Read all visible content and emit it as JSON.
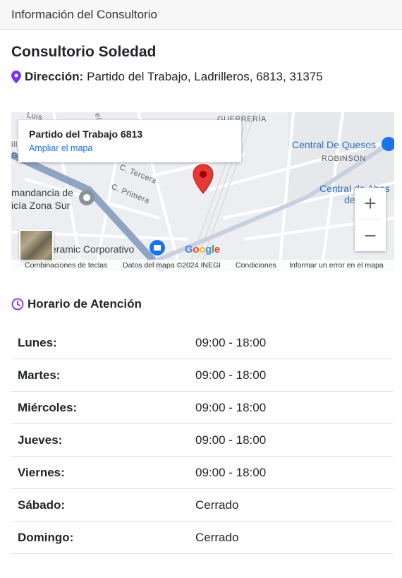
{
  "header": {
    "title": "Información del Consultorio"
  },
  "office": {
    "name": "Consultorio Soledad",
    "address_label": "Dirección:",
    "address_value": "Partido del Trabajo, Ladrilleros, 6813, 31375"
  },
  "map": {
    "info_title": "Partido del Trabajo 6813",
    "info_link": "Ampliar el mapa",
    "labels": {
      "guerreria": "GUERRERÍA",
      "robinson": "ROBINSON",
      "c_tercera": "C. Tercera",
      "c_primera": "C. Primera",
      "comandancia_1": "mandancia de",
      "comandancia_2": "icía Zona Sur",
      "ceramic": "eramic Corporativo",
      "quesos": "Central De Quesos",
      "abastos_1": "Central de Abas",
      "abastos_2": "de Agua",
      "luis": "Luis",
      "ga": "Ga",
      "ill": "ill",
      "ne": "el"
    },
    "google_letters": [
      "G",
      "o",
      "o",
      "g",
      "l",
      "e"
    ],
    "google_colors": [
      "#4285F4",
      "#EA4335",
      "#FBBC05",
      "#4285F4",
      "#34A853",
      "#EA4335"
    ],
    "zoom_in": "+",
    "zoom_out": "−",
    "footer": {
      "shortcuts": "Combinaciones de teclas",
      "data": "Datos del mapa ©2024 INEGI",
      "terms": "Condiciones",
      "report": "Informar un error en el mapa"
    },
    "pin_color": "#e53935"
  },
  "schedule": {
    "title": "Horario de Atención",
    "accent": "#7b2ff7",
    "days": [
      {
        "day": "Lunes:",
        "hours": "09:00 - 18:00"
      },
      {
        "day": "Martes:",
        "hours": "09:00 - 18:00"
      },
      {
        "day": "Miércoles:",
        "hours": "09:00 - 18:00"
      },
      {
        "day": "Jueves:",
        "hours": "09:00 - 18:00"
      },
      {
        "day": "Viernes:",
        "hours": "09:00 - 18:00"
      },
      {
        "day": "Sábado:",
        "hours": "Cerrado"
      },
      {
        "day": "Domingo:",
        "hours": "Cerrado"
      }
    ]
  }
}
